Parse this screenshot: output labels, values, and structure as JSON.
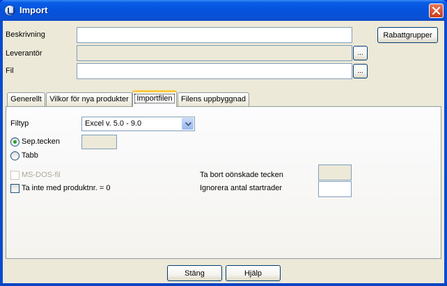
{
  "window": {
    "title": "Import"
  },
  "form": {
    "beskrivning_label": "Beskrivning",
    "beskrivning_value": "",
    "leverantor_label": "Leverantör",
    "leverantor_value": "",
    "fil_label": "Fil",
    "fil_value": "",
    "browse_label": "...",
    "rabattgrupper_label": "Rabattgrupper"
  },
  "tabs": [
    {
      "label": "Generellt",
      "active": false
    },
    {
      "label": "Vilkor för nya produkter",
      "active": false
    },
    {
      "label": "Importfilen",
      "active": true
    },
    {
      "label": "Filens uppbyggnad",
      "active": false
    }
  ],
  "importfilen": {
    "filtyp_label": "Filtyp",
    "filtyp_value": "Excel v. 5.0 - 9.0",
    "sep_tecken_label": "Sep.tecken",
    "sep_tecken_checked": true,
    "sep_tecken_value": "",
    "tabb_label": "Tabb",
    "tabb_checked": false,
    "msdos_label": "MS-DOS-fil",
    "msdos_enabled": false,
    "ta_inte_label": "Ta inte med produktnr. = 0",
    "ta_inte_checked": false,
    "ta_bort_label": "Ta bort oönskade tecken",
    "ta_bort_value": "",
    "ignorera_label": "Ignorera antal startrader",
    "ignorera_value": ""
  },
  "footer": {
    "stang_label": "Stäng",
    "hjalp_label": "Hjälp"
  },
  "colors": {
    "titlebar": "#0553dd",
    "dialog_bg": "#ece9d8",
    "radio_dot": "#21a121",
    "active_tab_accent": "#ffc83c"
  }
}
